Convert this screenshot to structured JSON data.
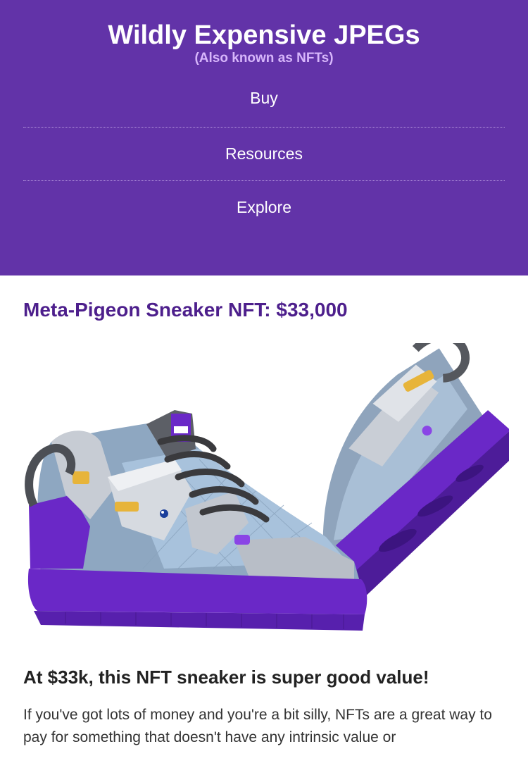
{
  "header": {
    "title": "Wildly Expensive JPEGs",
    "subtitle": "(Also known as NFTs)",
    "nav": [
      "Buy",
      "Resources",
      "Explore"
    ]
  },
  "main": {
    "product_title": "Meta-Pigeon Sneaker NFT: $33,000",
    "section_heading": "At $33k, this NFT sneaker is super good value!",
    "body_text": "If you've got lots of money and you're a bit silly, NFTs are a great way to pay for something that doesn't have any intrinsic value or"
  },
  "colors": {
    "header_bg": "#6233a8",
    "subtitle": "#d7b6fb",
    "product_title": "#4d1f8c",
    "sole_purple": "#6a28c7"
  }
}
